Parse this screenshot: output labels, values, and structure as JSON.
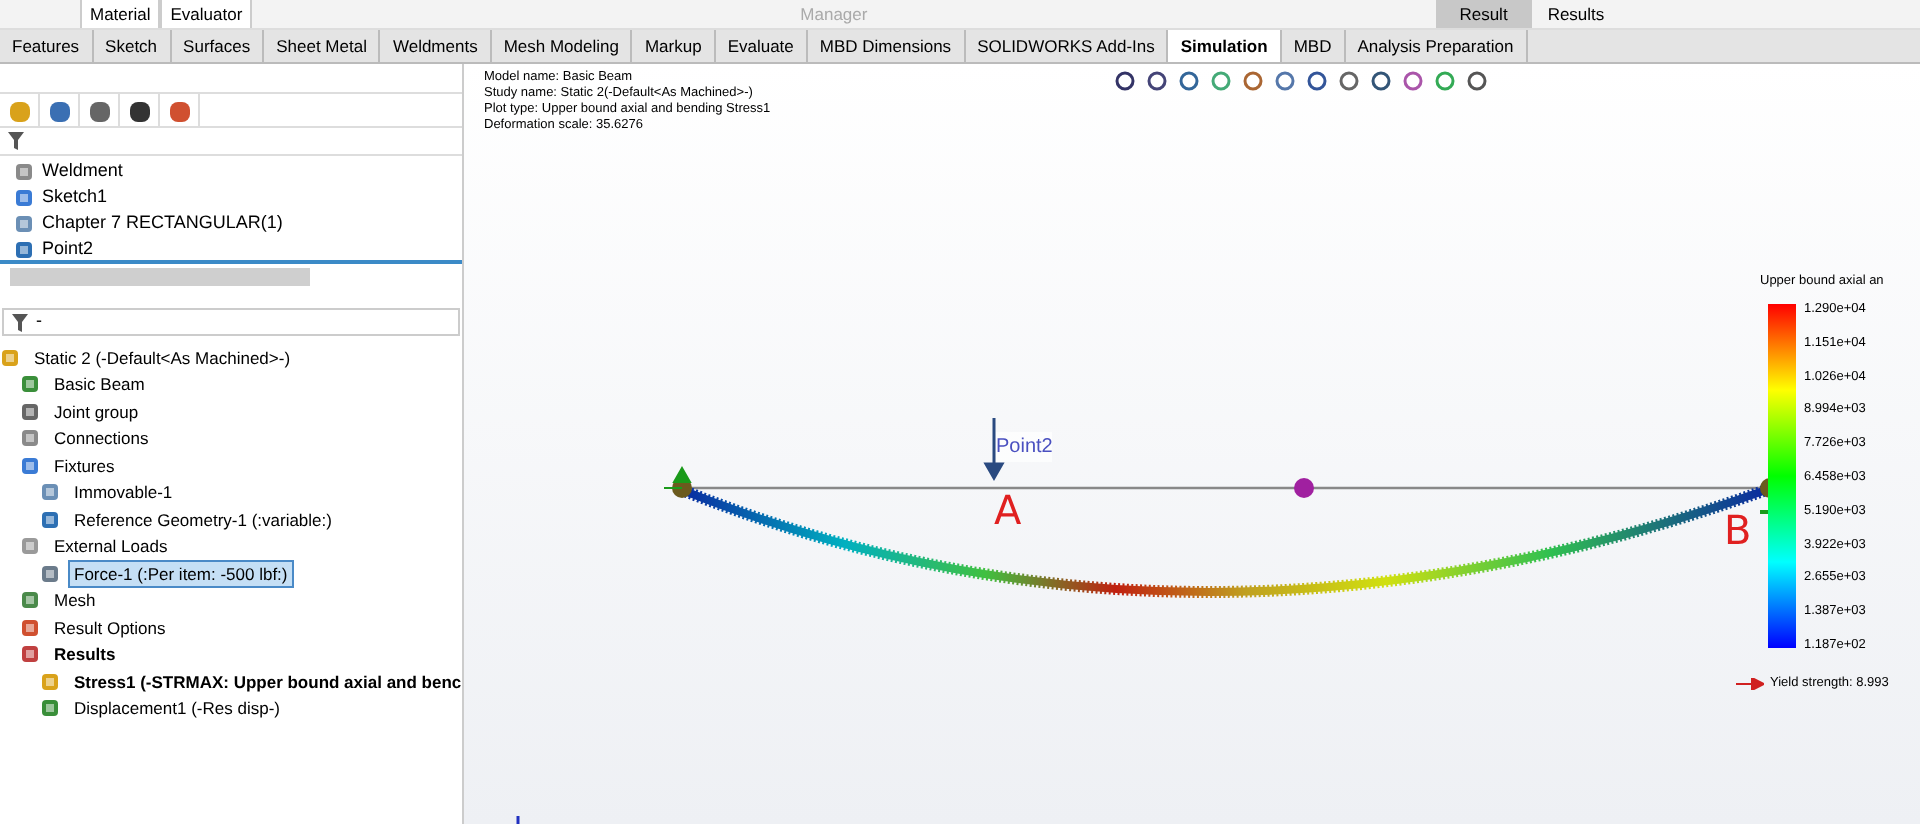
{
  "top_bar": {
    "items": [
      {
        "label": "Material",
        "kind": "box"
      },
      {
        "label": "Evaluator",
        "kind": "box"
      },
      {
        "label": "Manager",
        "kind": "disabled"
      },
      {
        "label": "Result",
        "kind": "pressed"
      },
      {
        "label": "Results",
        "kind": "plain"
      }
    ]
  },
  "tabs": [
    {
      "label": "Features",
      "selected": false
    },
    {
      "label": "Sketch",
      "selected": false
    },
    {
      "label": "Surfaces",
      "selected": false
    },
    {
      "label": "Sheet Metal",
      "selected": false
    },
    {
      "label": "Weldments",
      "selected": false
    },
    {
      "label": "Mesh Modeling",
      "selected": false
    },
    {
      "label": "Markup",
      "selected": false
    },
    {
      "label": "Evaluate",
      "selected": false
    },
    {
      "label": "MBD Dimensions",
      "selected": false
    },
    {
      "label": "SOLIDWORKS Add-Ins",
      "selected": false
    },
    {
      "label": "Simulation",
      "selected": true
    },
    {
      "label": "MBD",
      "selected": false
    },
    {
      "label": "Analysis Preparation",
      "selected": false
    }
  ],
  "feature_tree": {
    "items": [
      "Weldment",
      "Sketch1",
      "Chapter 7 RECTANGULAR(1)",
      "Point2"
    ]
  },
  "study_filter": {
    "value": "-"
  },
  "study_tree": {
    "label": "Static 2 (-Default<As Machined>-)",
    "children": [
      {
        "label": "Basic Beam",
        "bold": false,
        "selected": false
      },
      {
        "label": "Joint group",
        "bold": false,
        "selected": false
      },
      {
        "label": "Connections",
        "bold": false,
        "selected": false
      },
      {
        "label": "Fixtures",
        "bold": false,
        "selected": false,
        "children": [
          {
            "label": "Immovable-1",
            "bold": false,
            "selected": false
          },
          {
            "label": "Reference Geometry-1 (:variable:)",
            "bold": false,
            "selected": false
          }
        ]
      },
      {
        "label": "External Loads",
        "bold": false,
        "selected": false,
        "children": [
          {
            "label": "Force-1 (:Per item: -500 lbf:)",
            "bold": false,
            "selected": true
          }
        ]
      },
      {
        "label": "Mesh",
        "bold": false,
        "selected": false
      },
      {
        "label": "Result Options",
        "bold": false,
        "selected": false
      },
      {
        "label": "Results",
        "bold": true,
        "selected": false,
        "children": [
          {
            "label": "Stress1 (-STRMAX: Upper bound axial and benc",
            "bold": true,
            "selected": false
          },
          {
            "label": "Displacement1 (-Res disp-)",
            "bold": false,
            "selected": false
          }
        ]
      }
    ]
  },
  "plot_info": [
    "Model name: Basic Beam",
    "Study name: Static 2(-Default<As Machined>-)",
    "Plot type: Upper bound axial and bending Stress1",
    "Deformation scale: 35.6276"
  ],
  "viewport": {
    "point_label": "Point2",
    "marker_a": "A",
    "marker_b": "B"
  },
  "legend": {
    "title": "Upper bound axial an",
    "ticks": [
      "1.290e+04",
      "1.151e+04",
      "1.026e+04",
      "8.994e+03",
      "7.726e+03",
      "6.458e+03",
      "5.190e+03",
      "3.922e+03",
      "2.655e+03",
      "1.387e+03",
      "1.187e+02"
    ],
    "yield": "Yield strength: 8.993"
  }
}
